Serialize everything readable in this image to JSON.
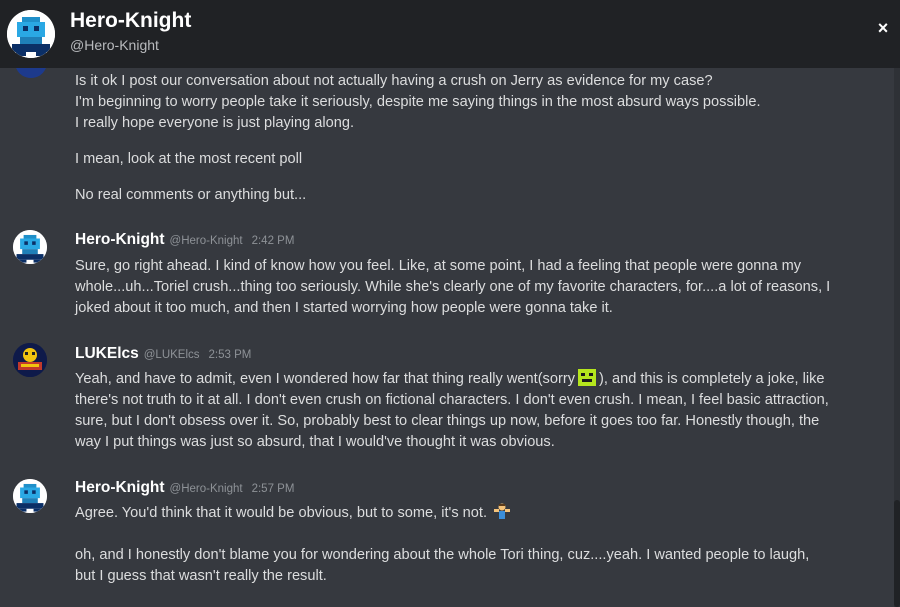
{
  "header": {
    "name": "Hero-Knight",
    "handle": "@Hero-Knight",
    "close_icon": "×"
  },
  "continued_message": {
    "lines": [
      "Is it ok I post our conversation about not actually having a crush on Jerry as evidence for my case?",
      "I'm beginning to worry people take it seriously, despite me saying things in the most absurd ways possible.",
      "I really hope everyone is just playing along.",
      "I mean, look at the most recent poll",
      "No real comments or anything but..."
    ]
  },
  "messages": [
    {
      "author": "Hero-Knight",
      "handle": "@Hero-Knight",
      "time": "2:42 PM",
      "lines": [
        "Sure, go right ahead. I kind of know how you feel. Like, at some point, I had a feeling that people were gonna my",
        "whole...uh...Toriel crush...thing too seriously. While she's clearly one of my favorite characters, for....a lot of reasons, I",
        "joked about it too much, and then I started worrying how people were gonna take it."
      ]
    },
    {
      "author": "LUKElcs",
      "handle": "@LUKElcs",
      "time": "2:53 PM",
      "line1_before": "Yeah, and have to admit, even I wondered how far that thing really went(sorry",
      "line1_after": "), and this is completely a joke, like",
      "lines": [
        "there's not truth to it at all. I don't even crush on fictional characters. I don't even crush. I mean, I feel basic attraction,",
        "sure, but I don't obsess over it. So, probably best to clear things up now, before it goes too far. Honestly though, the",
        "way I put things was just so absurd, that I would've thought it was obvious."
      ]
    },
    {
      "author": "Hero-Knight",
      "handle": "@Hero-Knight",
      "time": "2:57 PM",
      "line1": "Agree. You'd think that it would be obvious, but to some, it's not.",
      "lines": [
        "oh, and I honestly don't blame you for wondering about the whole Tori thing, cuz....yeah. I wanted people to laugh,",
        "but I guess that wasn't really the result."
      ]
    }
  ],
  "colors": {
    "background": "#36393f",
    "header": "#202225",
    "text": "#dcddde",
    "author": "#ffffff",
    "meta": "#8e9297"
  }
}
